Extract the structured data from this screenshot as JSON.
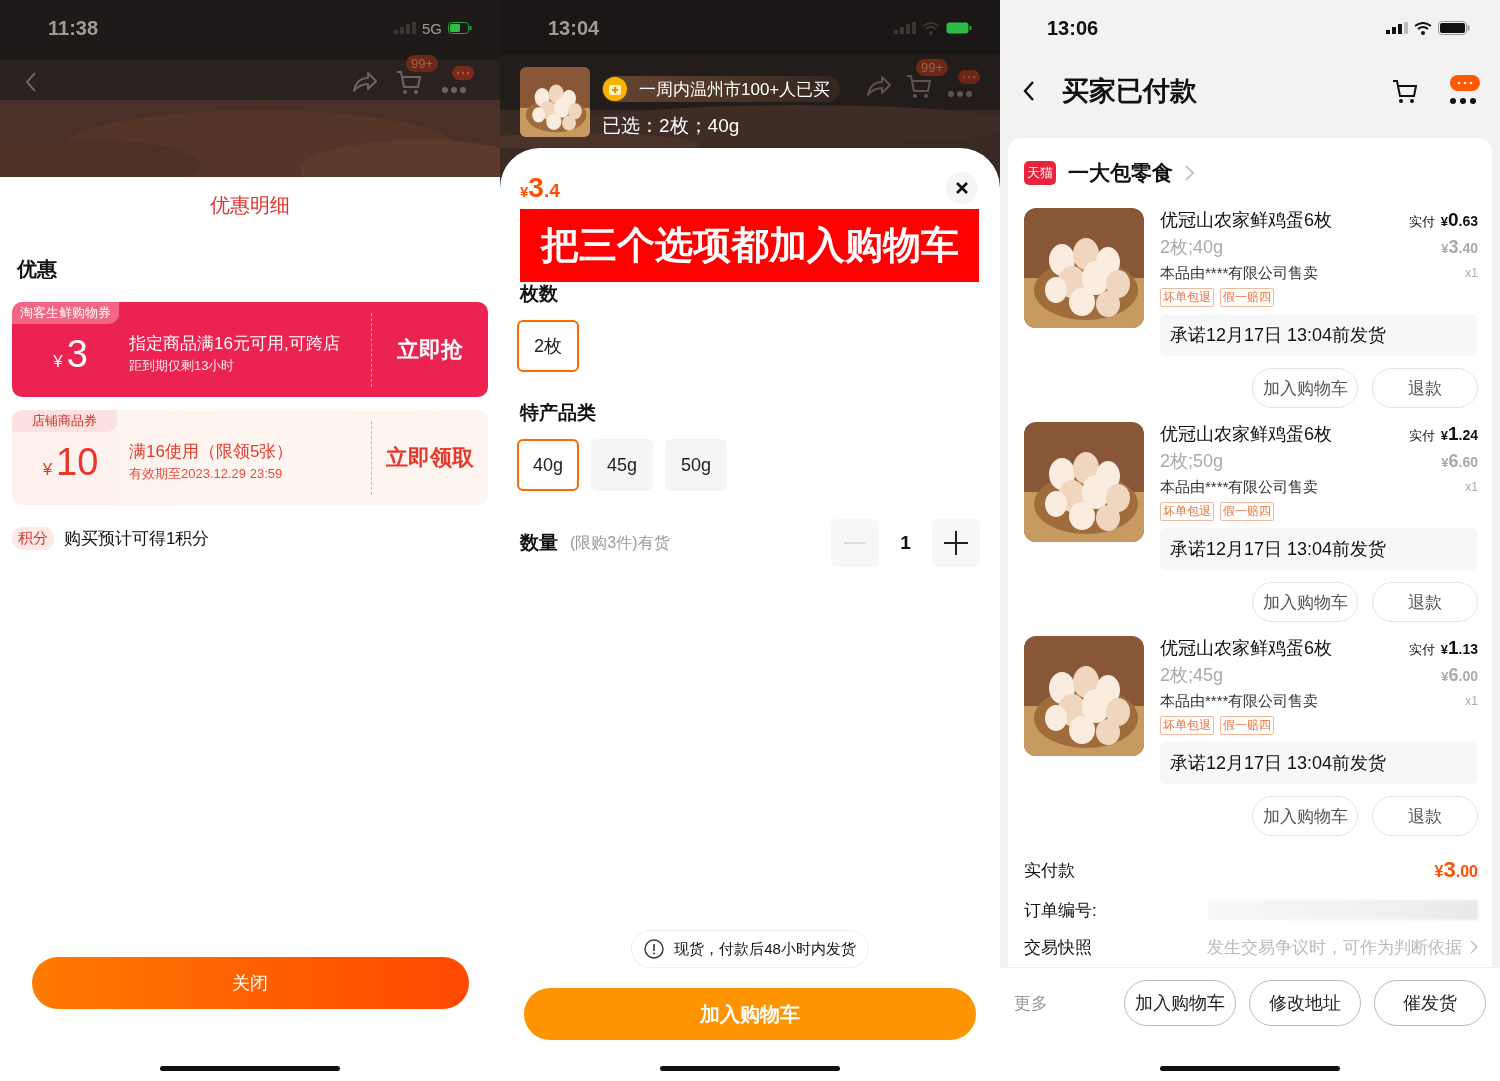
{
  "coupon_screen": {
    "status_bar": {
      "time": "11:38",
      "network": "5G"
    },
    "nav": {
      "cart_badge": "99+"
    },
    "sheet": {
      "title": "优惠明细",
      "section": "优惠",
      "coupons": [
        {
          "kind": "platform",
          "tag": "淘客生鲜购物券",
          "amount": "¥3",
          "condition": "指定商品满16元可用,可跨店",
          "note": "距到期仅剩13小时",
          "action": "立即抢"
        },
        {
          "kind": "shop",
          "tag": "店铺商品券",
          "amount": "¥10",
          "condition": "满16使用（限领5张）",
          "note": "有效期至2023.12.29 23:59",
          "action": "立即领取"
        }
      ],
      "points": {
        "tag": "积分",
        "text": "购买预计可得1积分"
      },
      "close_button": "关闭"
    }
  },
  "sku_screen": {
    "status_bar": {
      "time": "13:04"
    },
    "nav": {
      "cart_badge": "99+"
    },
    "header": {
      "social_proof": "一周内温州市100+人已买",
      "selection": "已选：2枚；40g"
    },
    "price": "¥3.4",
    "banner": "把三个选项都加入购物车",
    "option_groups": [
      {
        "label": "枚数",
        "options": [
          {
            "label": "2枚",
            "selected": true
          }
        ]
      },
      {
        "label": "特产品类",
        "options": [
          {
            "label": "40g",
            "selected": true
          },
          {
            "label": "45g",
            "selected": false
          },
          {
            "label": "50g",
            "selected": false
          }
        ]
      }
    ],
    "quantity": {
      "label": "数量",
      "hint": "(限购3件)有货",
      "value": "1",
      "decrease_disabled": true
    },
    "notice": "现货，付款后48小时内发货",
    "add_button": "加入购物车"
  },
  "order_screen": {
    "status_bar": {
      "time": "13:06"
    },
    "title": "买家已付款",
    "shop": {
      "badge": "天猫",
      "name": "一大包零食"
    },
    "items": [
      {
        "title": "优冠山农家鲜鸡蛋6枚",
        "paid_label": "实付",
        "paid": "¥0.63",
        "spec": "2枚;40g",
        "price": "¥3.40",
        "seller": "本品由****有限公司售卖",
        "qty": "x1",
        "tags": [
          "坏单包退",
          "假一赔四"
        ],
        "promise": "承诺12月17日 13:04前发货",
        "actions": [
          "加入购物车",
          "退款"
        ]
      },
      {
        "title": "优冠山农家鲜鸡蛋6枚",
        "paid_label": "实付",
        "paid": "¥1.24",
        "spec": "2枚;50g",
        "price": "¥6.60",
        "seller": "本品由****有限公司售卖",
        "qty": "x1",
        "tags": [
          "坏单包退",
          "假一赔四"
        ],
        "promise": "承诺12月17日 13:04前发货",
        "actions": [
          "加入购物车",
          "退款"
        ]
      },
      {
        "title": "优冠山农家鲜鸡蛋6枚",
        "paid_label": "实付",
        "paid": "¥1.13",
        "spec": "2枚;45g",
        "price": "¥6.00",
        "seller": "本品由****有限公司售卖",
        "qty": "x1",
        "tags": [
          "坏单包退",
          "假一赔四"
        ],
        "promise": "承诺12月17日 13:04前发货",
        "actions": [
          "加入购物车",
          "退款"
        ]
      }
    ],
    "summary": [
      {
        "kind": "price",
        "label": "实付款",
        "value": "¥3.00"
      },
      {
        "kind": "redacted",
        "label": "订单编号:"
      },
      {
        "kind": "link",
        "label": "交易快照",
        "value": "发生交易争议时，可作为判断依据"
      }
    ],
    "bottom_bar": {
      "more": "更多",
      "buttons": [
        "加入购物车",
        "修改地址",
        "催发货"
      ]
    }
  }
}
